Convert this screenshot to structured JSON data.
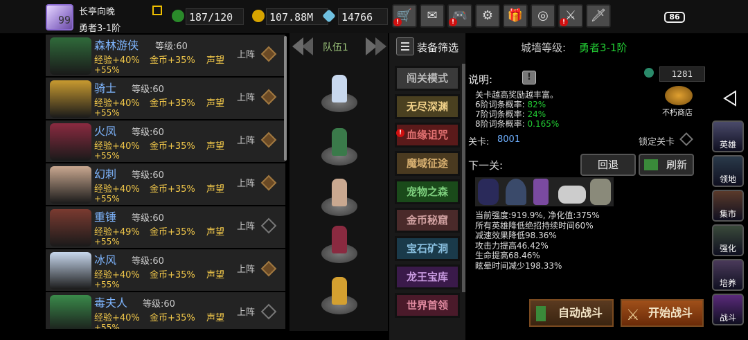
{
  "player": {
    "level": "99",
    "name": "长亭向晚",
    "rank": "勇者3-1阶"
  },
  "resources": {
    "stamina": "187/120",
    "gold": "107.88M",
    "gems": "14766"
  },
  "battery": "86",
  "top_buttons": [
    "shop-cart-icon",
    "mail-icon",
    "gamepad-icon",
    "gear-icon",
    "gift-icon",
    "color-wheel-icon",
    "crossed-swords-icon",
    "sword-icon"
  ],
  "colors": {
    "hero_name": "#7fb6ff",
    "bonus": "#f2c84a",
    "accent_green": "#22cc33"
  },
  "heroes": [
    {
      "name": "森林游侠",
      "level": "等级:60",
      "exp": "经验+40%",
      "gold": "金币+35%",
      "prestige": "声望",
      "plus": "+55%",
      "deploy": "上阵",
      "selected": true
    },
    {
      "name": "骑士",
      "level": "等级:60",
      "exp": "经验+40%",
      "gold": "金币+35%",
      "prestige": "声望",
      "plus": "+55%",
      "deploy": "上阵",
      "selected": true
    },
    {
      "name": "火凤",
      "level": "等级:60",
      "exp": "经验+40%",
      "gold": "金币+35%",
      "prestige": "声望",
      "plus": "+55%",
      "deploy": "上阵",
      "selected": true
    },
    {
      "name": "幻刺",
      "level": "等级:60",
      "exp": "经验+40%",
      "gold": "金币+35%",
      "prestige": "声望",
      "plus": "+55%",
      "deploy": "上阵",
      "selected": true
    },
    {
      "name": "重锤",
      "level": "等级:60",
      "exp": "经验+49%",
      "gold": "金币+35%",
      "prestige": "声望",
      "plus": "+55%",
      "deploy": "上阵",
      "selected": false
    },
    {
      "name": "冰风",
      "level": "等级:60",
      "exp": "经验+40%",
      "gold": "金币+35%",
      "prestige": "声望",
      "plus": "+55%",
      "deploy": "上阵",
      "selected": true
    },
    {
      "name": "毒夫人",
      "level": "等级:60",
      "exp": "经验+40%",
      "gold": "金币+35%",
      "prestige": "声望",
      "plus": "+55%",
      "deploy": "上阵",
      "selected": false
    }
  ],
  "team": {
    "label": "队伍1"
  },
  "filter": {
    "label": "装备筛选",
    "wall_label": "城墙等级:",
    "wall_value": "勇者3-1阶"
  },
  "modes": [
    {
      "label": "闯关模式",
      "alert": false
    },
    {
      "label": "无尽深渊",
      "alert": false
    },
    {
      "label": "血缘诅咒",
      "alert": true
    },
    {
      "label": "魔域征途",
      "alert": false
    },
    {
      "label": "宠物之森",
      "alert": false
    },
    {
      "label": "金币秘窟",
      "alert": false
    },
    {
      "label": "宝石矿洞",
      "alert": false
    },
    {
      "label": "龙王宝库",
      "alert": false
    },
    {
      "label": "世界首领",
      "alert": false
    }
  ],
  "info": {
    "title": "说明:",
    "desc": "关卡越高奖励越丰富。",
    "rates": [
      {
        "label": "6阶词条概率:",
        "value": "82%"
      },
      {
        "label": "7阶词条概率:",
        "value": "24%"
      },
      {
        "label": "8阶词条概率:",
        "value": "0.165%"
      }
    ],
    "stage_label": "关卡:",
    "stage_value": "8001",
    "lock_label": "锁定关卡",
    "next_label": "下一关:",
    "back_label": "回退",
    "refresh_label": "刷新",
    "shop_count": "1281",
    "shop_label": "不朽商店",
    "stats": [
      "当前强度:919.9%, 净化值:375%",
      "所有英雄降低绝招持续时间60%",
      "减速效果降低98.36%",
      "攻击力提高46.42%",
      "生命提高68.46%",
      "眩晕时间减少198.33%"
    ]
  },
  "actions": {
    "auto": "自动战斗",
    "start": "开始战斗"
  },
  "side_nav": [
    {
      "label": "英雄",
      "icon": "hero-icon"
    },
    {
      "label": "领地",
      "icon": "territory-icon"
    },
    {
      "label": "集市",
      "icon": "market-icon"
    },
    {
      "label": "强化",
      "icon": "enhance-icon"
    },
    {
      "label": "培养",
      "icon": "train-icon"
    },
    {
      "label": "战斗",
      "icon": "battle-icon"
    }
  ]
}
